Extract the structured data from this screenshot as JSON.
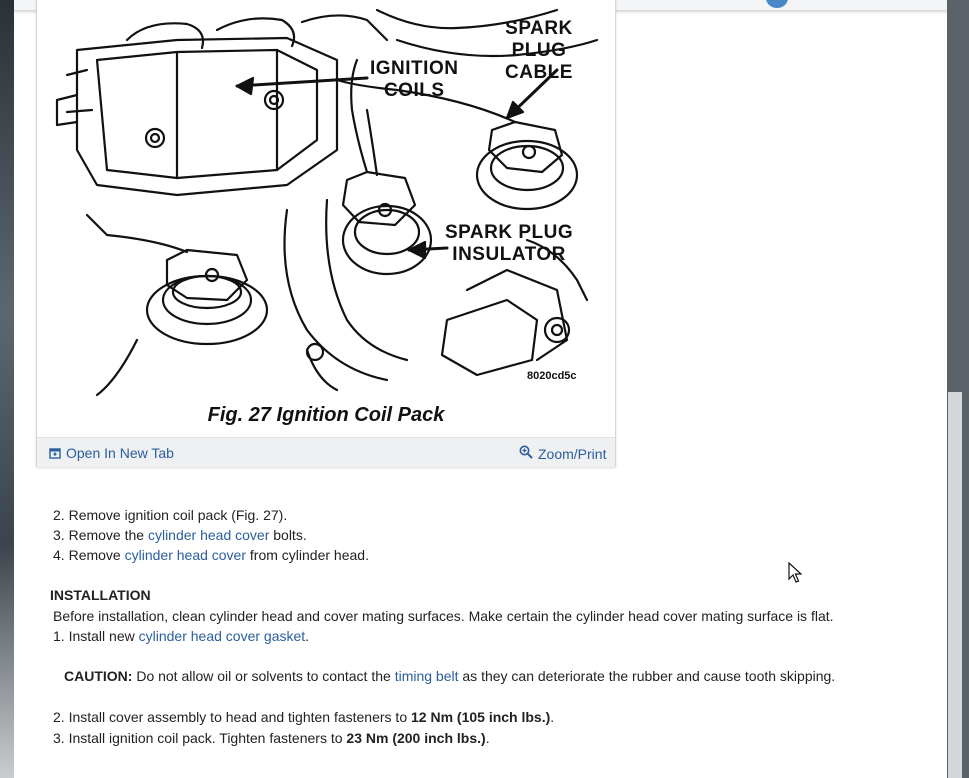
{
  "figure": {
    "caption": "Fig. 27 Ignition Coil Pack",
    "code": "8020cd5c",
    "callouts": {
      "ignition_coils_1": "IGNITION",
      "ignition_coils_2": "COILS",
      "spark_plug_cable_1": "SPARK",
      "spark_plug_cable_2": "PLUG",
      "spark_plug_cable_3": "CABLE",
      "spark_plug_insulator_1": "SPARK PLUG",
      "spark_plug_insulator_2": "INSULATOR"
    },
    "open_new_tab": "Open In New Tab",
    "zoom_print": "Zoom/Print"
  },
  "steps_removal": [
    {
      "num": "2.",
      "pre": "Remove ignition coil pack (Fig. 27).",
      "link": "",
      "post": ""
    },
    {
      "num": "3.",
      "pre": "Remove the ",
      "link": "cylinder head cover",
      "post": " bolts."
    },
    {
      "num": "4.",
      "pre": "Remove ",
      "link": "cylinder head cover",
      "post": " from cylinder head."
    }
  ],
  "installation": {
    "heading": "INSTALLATION",
    "intro": "Before installation, clean cylinder head and cover mating surfaces. Make certain the cylinder head cover mating surface is flat.",
    "step1_num": "1.",
    "step1_pre": "Install new ",
    "step1_link": "cylinder head cover gasket",
    "step1_post": ".",
    "caution_label": "CAUTION:",
    "caution_pre": " Do not allow oil or solvents to contact the ",
    "caution_link": "timing belt",
    "caution_post": " as they can deteriorate the rubber and cause tooth skipping.",
    "step2_num": "2.",
    "step2_pre": "Install cover assembly to head and tighten fasteners to ",
    "step2_bold": "12 Nm (105 inch lbs.)",
    "step2_post": ".",
    "step3_num": "3.",
    "step3_pre": "Install ignition coil pack. Tighten fasteners to ",
    "step3_bold": "23 Nm (200 inch lbs.)",
    "step3_post": "."
  }
}
